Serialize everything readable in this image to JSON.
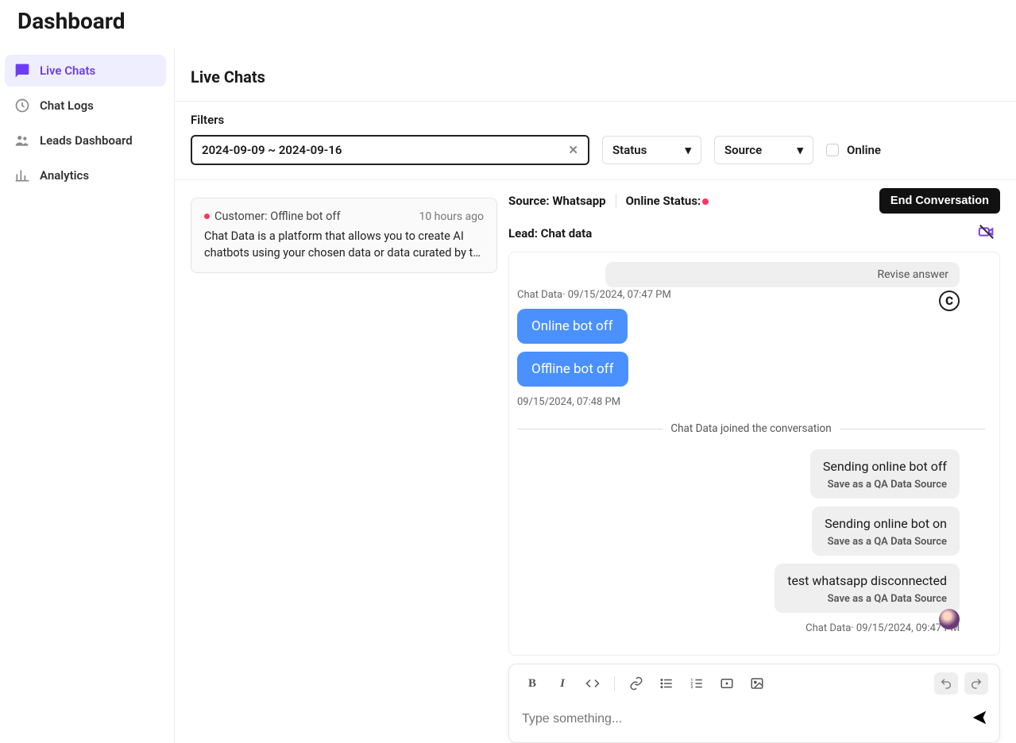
{
  "page_title": "Dashboard",
  "sidebar": {
    "items": [
      {
        "label": "Live Chats",
        "active": true
      },
      {
        "label": "Chat Logs",
        "active": false
      },
      {
        "label": "Leads Dashboard",
        "active": false
      },
      {
        "label": "Analytics",
        "active": false
      }
    ]
  },
  "section_title": "Live Chats",
  "filters": {
    "label": "Filters",
    "date_range": "2024-09-09 ~ 2024-09-16",
    "status_label": "Status",
    "source_label": "Source",
    "online_label": "Online"
  },
  "conv_list": [
    {
      "customer_label": "Customer: Offline bot off",
      "time": "10 hours ago",
      "snippet": "Chat Data is a platform that allows you to create AI chatbots using your chosen data or data curated by t…"
    }
  ],
  "chat": {
    "source_label": "Source: Whatsapp",
    "online_status_label": "Online Status:",
    "end_button": "End Conversation",
    "lead_label": "Lead: Chat data",
    "revise_answer": "Revise answer",
    "bot_sender_line": "Chat Data· 09/15/2024, 07:47 PM",
    "user_msgs": [
      "Online bot off",
      "Offline bot off"
    ],
    "user_time": "09/15/2024, 07:48 PM",
    "system_line": "Chat Data joined the conversation",
    "agent_msgs": [
      "Sending online bot off",
      "Sending online bot on",
      "test whatsapp disconnected"
    ],
    "save_qa": "Save as a QA Data Source",
    "agent_sender_line": "Chat Data· 09/15/2024, 09:47 PM"
  },
  "editor": {
    "placeholder": "Type something..."
  }
}
